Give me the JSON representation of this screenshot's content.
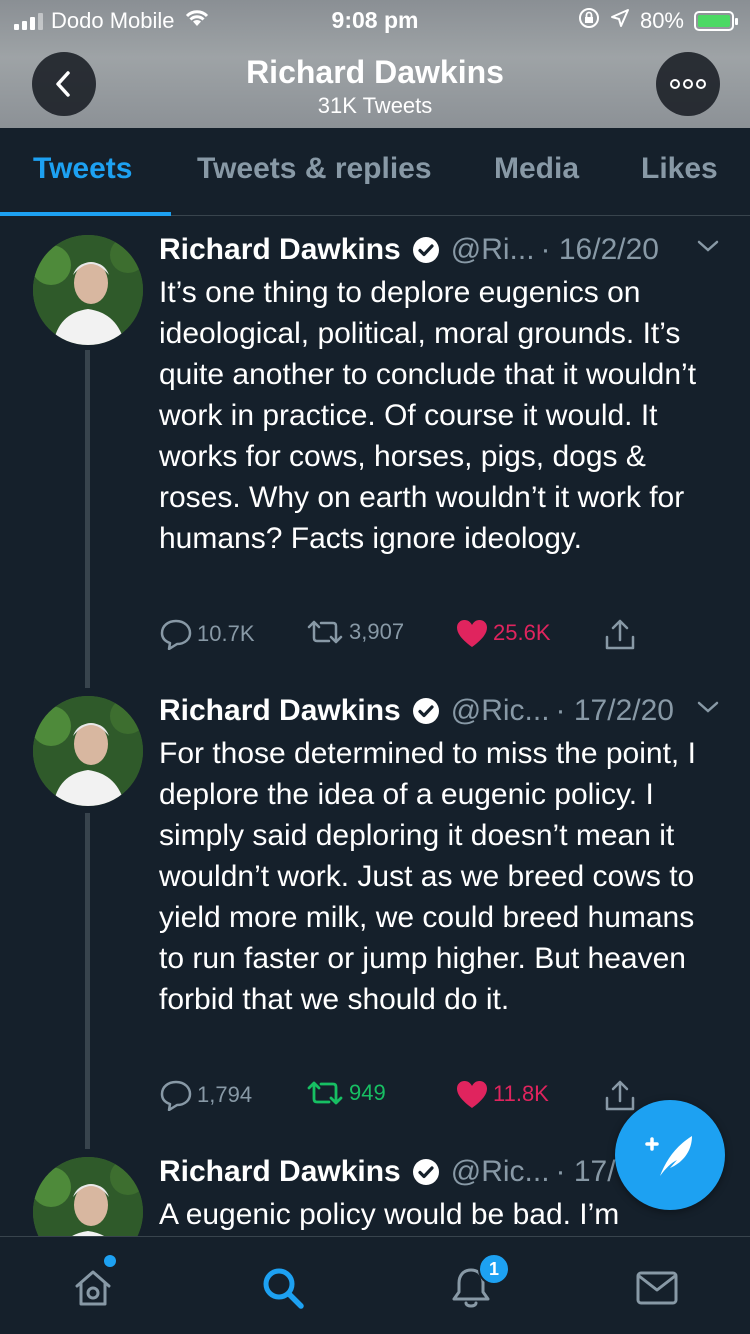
{
  "status_bar": {
    "carrier": "Dodo Mobile",
    "time": "9:08 pm",
    "battery": "80%"
  },
  "header": {
    "name": "Richard Dawkins",
    "tweet_count": "31K Tweets"
  },
  "tabs": [
    "Tweets",
    "Tweets & replies",
    "Media",
    "Likes"
  ],
  "active_tab": "Tweets",
  "colors": {
    "background": "#15202b",
    "accent": "#1da1f2",
    "retweet": "#17bf63",
    "like": "#e0245e",
    "muted": "#8899a6"
  },
  "tweets": [
    {
      "name": "Richard Dawkins",
      "handle": "@Ri...",
      "date": "· 16/2/20",
      "text": "It’s one thing to deplore eugenics on ideological, political, moral grounds. It’s quite another to conclude that it wouldn’t work in practice. Of course it would. It works for cows, horses, pigs, dogs & roses. Why on earth wouldn’t it work for humans? Facts ignore ideology.",
      "replies": "10.7K",
      "retweets": "3,907",
      "likes": "25.6K",
      "retweeted": false,
      "liked": true
    },
    {
      "name": "Richard Dawkins",
      "handle": "@Ric...",
      "date": "· 17/2/20",
      "text": "For those determined to miss the point, I deplore the idea of a eugenic policy. I simply said deploring it doesn’t mean it wouldn’t work. Just as we breed cows to yield more milk, we could breed humans to run faster or jump higher. But heaven forbid that we should do it.",
      "replies": "1,794",
      "retweets": "949",
      "likes": "11.8K",
      "retweeted": true,
      "liked": true
    },
    {
      "name": "Richard Dawkins",
      "handle": "@Ric...",
      "date": "· 17/",
      "text": "A eugenic policy would be bad. I’m"
    }
  ],
  "bottom_nav": {
    "notifications_badge": "1",
    "items": [
      "home-icon",
      "search-icon",
      "notifications-icon",
      "messages-icon"
    ]
  }
}
